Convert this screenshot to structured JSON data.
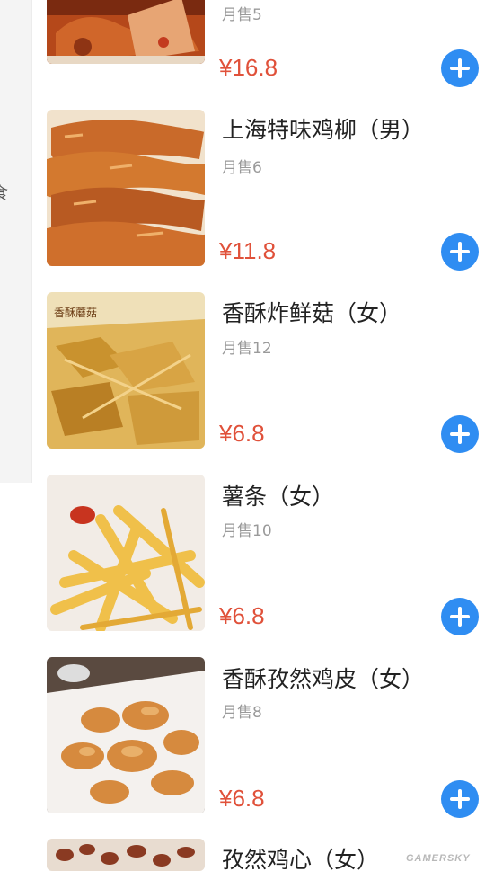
{
  "sidebar": {
    "category_fragment": "食"
  },
  "items": [
    {
      "name": "",
      "sales": "月售5",
      "price": "¥16.8",
      "image": "braised-meat-photo"
    },
    {
      "name": "上海特味鸡柳（男）",
      "sales": "月售6",
      "price": "¥11.8",
      "image": "fried-chicken-strips-photo"
    },
    {
      "name": "香酥炸鲜菇（女）",
      "sales": "月售12",
      "price": "¥6.8",
      "image": "fried-mushroom-photo",
      "photo_caption": "香酥蘑菇"
    },
    {
      "name": "薯条（女）",
      "sales": "月售10",
      "price": "¥6.8",
      "image": "french-fries-photo"
    },
    {
      "name": "香酥孜然鸡皮（女）",
      "sales": "月售8",
      "price": "¥6.8",
      "image": "fried-chicken-skin-photo"
    },
    {
      "name": "孜然鸡心（女）",
      "sales": "",
      "price": "",
      "image": "chicken-heart-photo"
    }
  ],
  "add_button_icon": "plus-icon",
  "watermark": "GAMERSKY",
  "colors": {
    "price": "#e0513a",
    "add_button": "#2f8df2",
    "sales_text": "#9a9a9a",
    "sidebar_bg": "#f4f4f4"
  }
}
